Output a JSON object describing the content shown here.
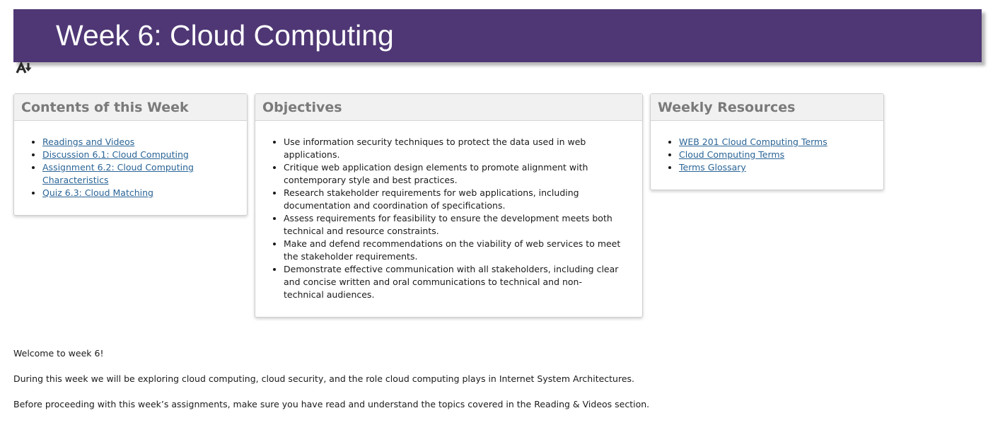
{
  "header": {
    "title": "Week 6: Cloud Computing"
  },
  "accessibility_icon": "text-to-speech-icon",
  "colors": {
    "header_bg": "#4f3775",
    "header_text": "#ffffff",
    "panel_header_bg": "#f1f1f1",
    "panel_header_text": "#7a7a7a",
    "link": "#2a6496"
  },
  "contents_panel": {
    "title": "Contents of this Week",
    "items": [
      "Readings and Videos",
      "Discussion 6.1: Cloud Computing",
      "Assignment 6.2: Cloud Computing Characteristics",
      "Quiz 6.3: Cloud Matching"
    ]
  },
  "objectives_panel": {
    "title": "Objectives",
    "items": [
      "Use information security techniques to protect the data used in web applications.",
      "Critique web application design elements to promote alignment with contemporary style and best practices.",
      "Research stakeholder requirements for web applications, including documentation and coordination of specifications.",
      "Assess requirements for feasibility to ensure the development meets both technical and resource constraints.",
      "Make and defend recommendations on the viability of web services to meet the stakeholder requirements.",
      "Demonstrate effective communication with all stakeholders, including clear and concise written and oral communications to technical and non-technical audiences."
    ]
  },
  "resources_panel": {
    "title": "Weekly Resources",
    "items": [
      "WEB 201 Cloud Computing Terms",
      "Cloud Computing Terms",
      "Terms Glossary"
    ]
  },
  "body": {
    "welcome": "Welcome to week 6!",
    "intro": "During this week we will be exploring cloud computing, cloud security, and the role cloud computing plays in Internet System Architectures.",
    "instructions": "Before proceeding with this week’s assignments, make sure you have read and understand the topics covered in the Reading & Videos section."
  }
}
